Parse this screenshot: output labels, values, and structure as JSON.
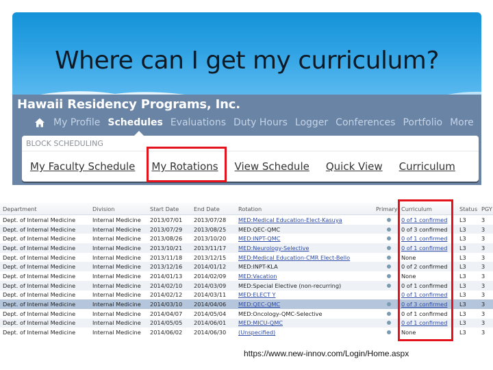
{
  "slide": {
    "title": "Where can I get my curriculum?",
    "caption_url": "https://www.new-innov.com/Login/Home.aspx",
    "highlight_color": "#e3121b"
  },
  "app": {
    "org_name": "Hawaii Residency Programs, Inc.",
    "nav": {
      "home_icon": "home-icon",
      "items": [
        {
          "label": "My Profile",
          "active": false
        },
        {
          "label": "Schedules",
          "active": true
        },
        {
          "label": "Evaluations",
          "active": false
        },
        {
          "label": "Duty Hours",
          "active": false
        },
        {
          "label": "Logger",
          "active": false
        },
        {
          "label": "Conferences",
          "active": false
        },
        {
          "label": "Portfolio",
          "active": false
        },
        {
          "label": "More",
          "active": false
        }
      ]
    },
    "sub_panel": {
      "section_label": "BLOCK SCHEDULING",
      "links": [
        {
          "label": "My Faculty Schedule",
          "highlighted": false
        },
        {
          "label": "My Rotations",
          "highlighted": true
        },
        {
          "label": "View Schedule",
          "highlighted": false
        },
        {
          "label": "Quick View",
          "highlighted": false
        },
        {
          "label": "Curriculum",
          "highlighted": false
        }
      ]
    }
  },
  "grid": {
    "columns": [
      "Department",
      "Division",
      "Start Date",
      "End Date",
      "Rotation",
      "Primary",
      "Curriculum",
      "Status",
      "PGY"
    ],
    "rows": [
      {
        "department": "Dept. of Internal Medicine",
        "division": "Internal Medicine",
        "start": "2013/07/01",
        "end": "2013/07/28",
        "rotation": "MED:Medical Education-Elect-Kasuya",
        "rotation_link": true,
        "primary": true,
        "curriculum": "0 of 1 confirmed",
        "curriculum_link": true,
        "status": "L3",
        "pgy": "3",
        "selected": false
      },
      {
        "department": "Dept. of Internal Medicine",
        "division": "Internal Medicine",
        "start": "2013/07/29",
        "end": "2013/08/25",
        "rotation": "MED:QEC-QMC",
        "rotation_link": false,
        "primary": true,
        "curriculum": "0 of 3 confirmed",
        "curriculum_link": false,
        "status": "L3",
        "pgy": "3",
        "selected": false
      },
      {
        "department": "Dept. of Internal Medicine",
        "division": "Internal Medicine",
        "start": "2013/08/26",
        "end": "2013/10/20",
        "rotation": "MED:INPT-QMC",
        "rotation_link": true,
        "primary": true,
        "curriculum": "0 of 1 confirmed",
        "curriculum_link": true,
        "status": "L3",
        "pgy": "3",
        "selected": false
      },
      {
        "department": "Dept. of Internal Medicine",
        "division": "Internal Medicine",
        "start": "2013/10/21",
        "end": "2013/11/17",
        "rotation": "MED:Neurology-Selective",
        "rotation_link": true,
        "primary": true,
        "curriculum": "0 of 1 confirmed",
        "curriculum_link": true,
        "status": "L3",
        "pgy": "3",
        "selected": false
      },
      {
        "department": "Dept. of Internal Medicine",
        "division": "Internal Medicine",
        "start": "2013/11/18",
        "end": "2013/12/15",
        "rotation": "MED:Medical Education-CMR Elect-Bello",
        "rotation_link": true,
        "primary": true,
        "curriculum": "None",
        "curriculum_link": false,
        "status": "L3",
        "pgy": "3",
        "selected": false
      },
      {
        "department": "Dept. of Internal Medicine",
        "division": "Internal Medicine",
        "start": "2013/12/16",
        "end": "2014/01/12",
        "rotation": "MED:INPT-KLA",
        "rotation_link": false,
        "primary": true,
        "curriculum": "0 of 2 confirmed",
        "curriculum_link": false,
        "status": "L3",
        "pgy": "3",
        "selected": false
      },
      {
        "department": "Dept. of Internal Medicine",
        "division": "Internal Medicine",
        "start": "2014/01/13",
        "end": "2014/02/09",
        "rotation": "MED:Vacation",
        "rotation_link": true,
        "primary": true,
        "curriculum": "None",
        "curriculum_link": false,
        "status": "L3",
        "pgy": "3",
        "selected": false
      },
      {
        "department": "Dept. of Internal Medicine",
        "division": "Internal Medicine",
        "start": "2014/02/10",
        "end": "2014/03/09",
        "rotation": "MED:Special Elective (non-recurring)",
        "rotation_link": false,
        "primary": true,
        "curriculum": "0 of 1 confirmed",
        "curriculum_link": false,
        "status": "L3",
        "pgy": "3",
        "selected": false
      },
      {
        "department": "Dept. of Internal Medicine",
        "division": "Internal Medicine",
        "start": "2014/02/12",
        "end": "2014/03/11",
        "rotation": "MED:ELECT Y",
        "rotation_link": true,
        "primary": false,
        "curriculum": "0 of 1 confirmed",
        "curriculum_link": true,
        "status": "L3",
        "pgy": "3",
        "selected": false
      },
      {
        "department": "Dept. of Internal Medicine",
        "division": "Internal Medicine",
        "start": "2014/03/10",
        "end": "2014/04/06",
        "rotation": "MED:QEC-QMC",
        "rotation_link": true,
        "primary": true,
        "curriculum": "0 of 3 confirmed",
        "curriculum_link": true,
        "status": "L3",
        "pgy": "3",
        "selected": true
      },
      {
        "department": "Dept. of Internal Medicine",
        "division": "Internal Medicine",
        "start": "2014/04/07",
        "end": "2014/05/04",
        "rotation": "MED:Oncology-QMC-Selective",
        "rotation_link": false,
        "primary": true,
        "curriculum": "0 of 1 confirmed",
        "curriculum_link": false,
        "status": "L3",
        "pgy": "3",
        "selected": false
      },
      {
        "department": "Dept. of Internal Medicine",
        "division": "Internal Medicine",
        "start": "2014/05/05",
        "end": "2014/06/01",
        "rotation": "MED:MICU-QMC",
        "rotation_link": true,
        "primary": true,
        "curriculum": "0 of 1 confirmed",
        "curriculum_link": true,
        "status": "L3",
        "pgy": "3",
        "selected": false
      },
      {
        "department": "Dept. of Internal Medicine",
        "division": "Internal Medicine",
        "start": "2014/06/02",
        "end": "2014/06/30",
        "rotation": "(Unspecified)",
        "rotation_link": true,
        "primary": true,
        "curriculum": "None",
        "curriculum_link": false,
        "status": "L3",
        "pgy": "3",
        "selected": false
      }
    ]
  }
}
